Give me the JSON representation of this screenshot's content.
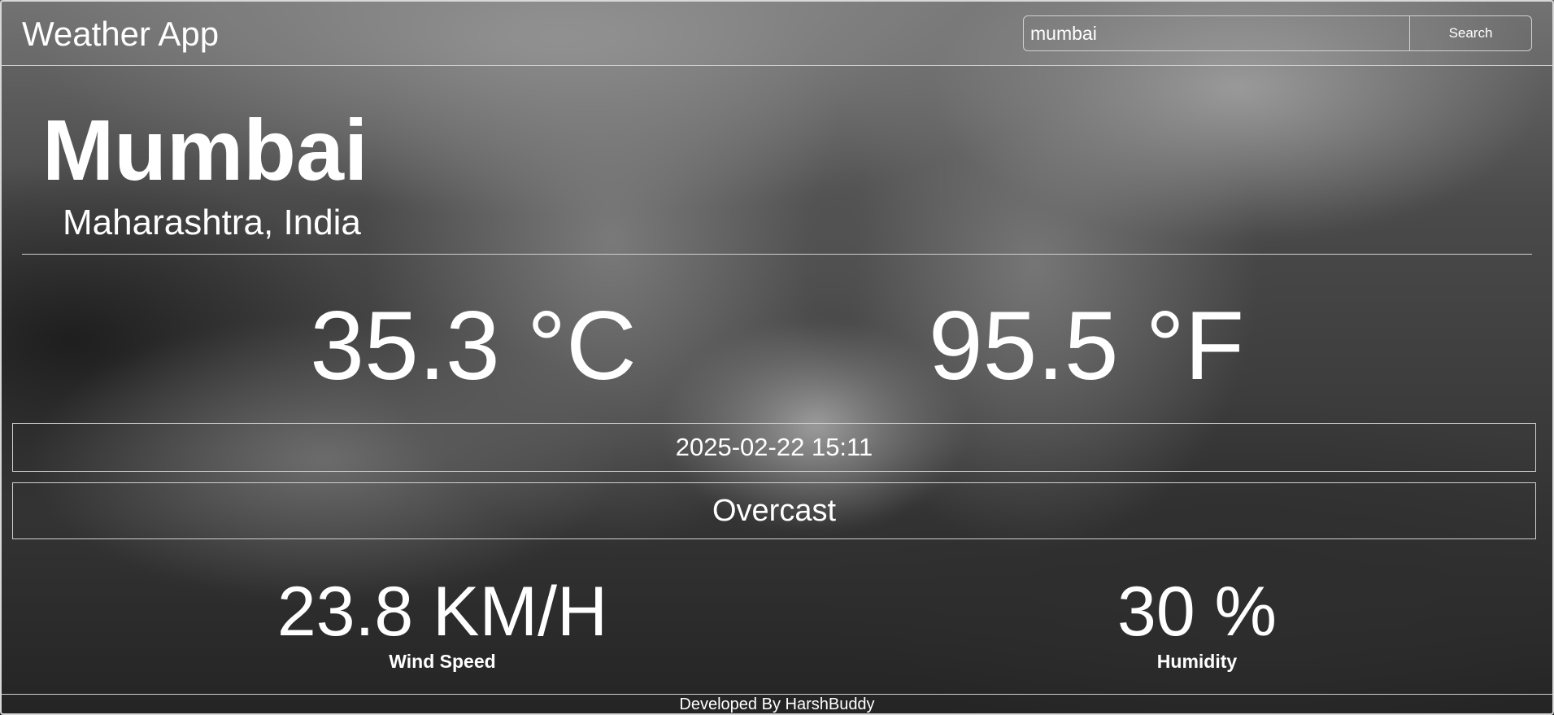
{
  "header": {
    "title": "Weather App",
    "search": {
      "value": "mumbai",
      "placeholder": "",
      "button_label": "Search"
    }
  },
  "location": {
    "city": "Mumbai",
    "region": "Maharashtra, India"
  },
  "temperature": {
    "celsius": "35.3 °C",
    "fahrenheit": "95.5 °F"
  },
  "datetime": "2025-02-22 15:11",
  "condition": "Overcast",
  "stats": {
    "wind": {
      "value": "23.8 KM/H",
      "label": "Wind Speed"
    },
    "humidity": {
      "value": "30 %",
      "label": "Humidity"
    }
  },
  "footer": {
    "credit": "Developed By HarshBuddy"
  },
  "colors": {
    "text": "#ffffff",
    "border": "#d0d0d0",
    "background": "#3a3a3a"
  }
}
